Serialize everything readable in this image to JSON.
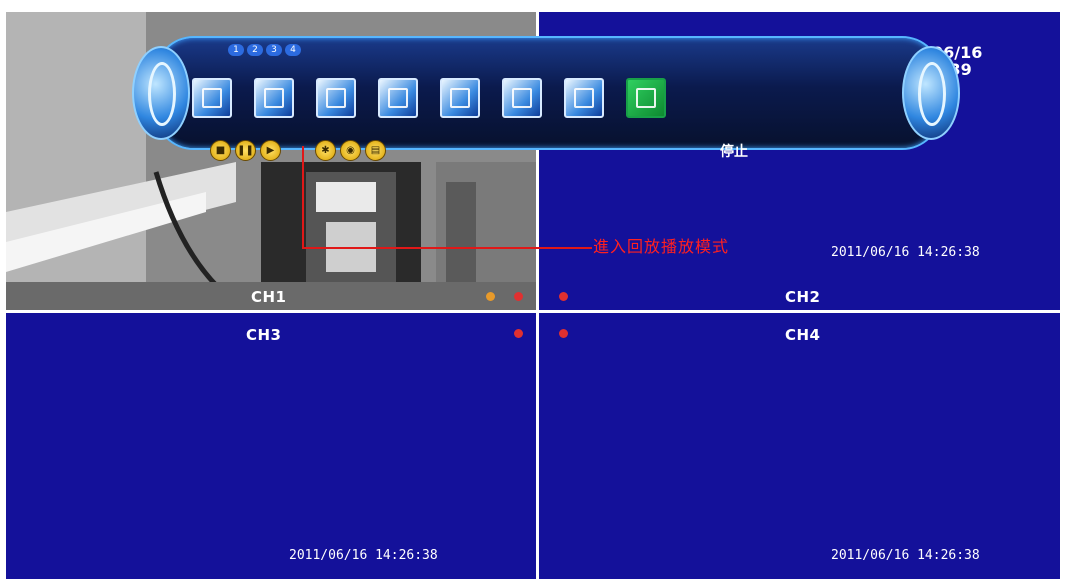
{
  "channels": {
    "ch1": {
      "label": "CH1"
    },
    "ch2": {
      "label": "CH2",
      "timestamp": "2011/06/16 14:26:38"
    },
    "ch3": {
      "label": "CH3",
      "timestamp": "2011/06/16 14:26:38"
    },
    "ch4": {
      "label": "CH4",
      "timestamp": "2011/06/16 14:26:38"
    }
  },
  "overlay_datetime": {
    "date": "06/16",
    "time": "6:39"
  },
  "toolbar": {
    "numbers": [
      "1",
      "2",
      "3",
      "4"
    ],
    "icons": [
      "screen-icon",
      "record-icon",
      "search-icon",
      "chart-icon",
      "network-icon",
      "split-icon",
      "window-icon",
      "grid-icon"
    ],
    "playback_buttons": [
      "stop",
      "pause",
      "play"
    ],
    "extra_buttons": [
      "settings",
      "snapshot",
      "backup"
    ],
    "caption": "停止"
  },
  "callout": "進入回放播放模式",
  "colors": {
    "channel_bg": "#14119a",
    "callout": "#ff2020",
    "toolbar_border": "#57b6ff"
  }
}
